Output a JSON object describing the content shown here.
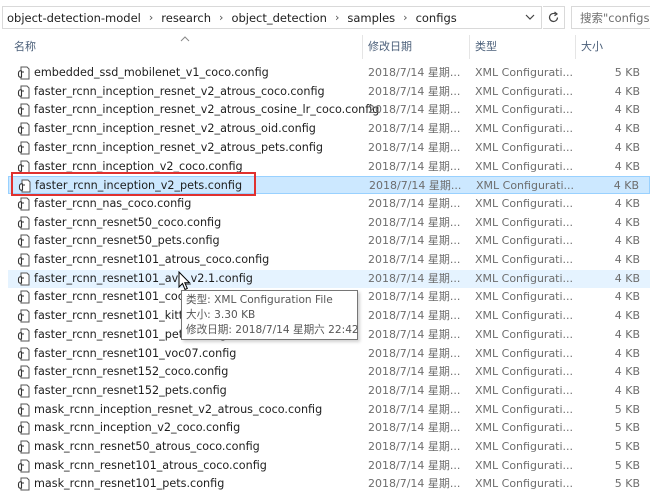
{
  "address": {
    "crumbs": [
      "object-detection-model",
      "research",
      "object_detection",
      "samples",
      "configs"
    ],
    "search_placeholder": "搜索\"configs\""
  },
  "columns": {
    "name": "名称",
    "date": "修改日期",
    "type": "类型",
    "size": "大小"
  },
  "files": [
    {
      "name": "embedded_ssd_mobilenet_v1_coco.config",
      "date": "2018/7/14 星期...",
      "type": "XML Configurati...",
      "size": "5 KB"
    },
    {
      "name": "faster_rcnn_inception_resnet_v2_atrous_coco.config",
      "date": "2018/7/14 星期...",
      "type": "XML Configurati...",
      "size": "4 KB"
    },
    {
      "name": "faster_rcnn_inception_resnet_v2_atrous_cosine_lr_coco.config",
      "date": "2018/7/14 星期...",
      "type": "XML Configurati...",
      "size": "4 KB"
    },
    {
      "name": "faster_rcnn_inception_resnet_v2_atrous_oid.config",
      "date": "2018/7/14 星期...",
      "type": "XML Configurati...",
      "size": "4 KB"
    },
    {
      "name": "faster_rcnn_inception_resnet_v2_atrous_pets.config",
      "date": "2018/7/14 星期...",
      "type": "XML Configurati...",
      "size": "4 KB"
    },
    {
      "name": "faster_rcnn_inception_v2_coco.config",
      "date": "2018/7/14 星期...",
      "type": "XML Configurati...",
      "size": "4 KB"
    },
    {
      "name": "faster_rcnn_inception_v2_pets.config",
      "date": "2018/7/14 星期...",
      "type": "XML Configurati...",
      "size": "4 KB"
    },
    {
      "name": "faster_rcnn_nas_coco.config",
      "date": "2018/7/14 星期...",
      "type": "XML Configurati...",
      "size": "4 KB"
    },
    {
      "name": "faster_rcnn_resnet50_coco.config",
      "date": "2018/7/14 星期...",
      "type": "XML Configurati...",
      "size": "4 KB"
    },
    {
      "name": "faster_rcnn_resnet50_pets.config",
      "date": "2018/7/14 星期...",
      "type": "XML Configurati...",
      "size": "4 KB"
    },
    {
      "name": "faster_rcnn_resnet101_atrous_coco.config",
      "date": "2018/7/14 星期...",
      "type": "XML Configurati...",
      "size": "4 KB"
    },
    {
      "name": "faster_rcnn_resnet101_ava_v2.1.config",
      "date": "2018/7/14 星期...",
      "type": "XML Configurati...",
      "size": "4 KB"
    },
    {
      "name": "faster_rcnn_resnet101_coco.config",
      "date": "2018/7/14 星期...",
      "type": "XML Configurati...",
      "size": "4 KB"
    },
    {
      "name": "faster_rcnn_resnet101_kitti.config",
      "date": "2018/7/14 星期...",
      "type": "XML Configurati...",
      "size": "4 KB"
    },
    {
      "name": "faster_rcnn_resnet101_pets.config",
      "date": "2018/7/14 星期...",
      "type": "XML Configurati...",
      "size": "4 KB"
    },
    {
      "name": "faster_rcnn_resnet101_voc07.config",
      "date": "2018/7/14 星期...",
      "type": "XML Configurati...",
      "size": "4 KB"
    },
    {
      "name": "faster_rcnn_resnet152_coco.config",
      "date": "2018/7/14 星期...",
      "type": "XML Configurati...",
      "size": "4 KB"
    },
    {
      "name": "faster_rcnn_resnet152_pets.config",
      "date": "2018/7/14 星期...",
      "type": "XML Configurati...",
      "size": "4 KB"
    },
    {
      "name": "mask_rcnn_inception_resnet_v2_atrous_coco.config",
      "date": "2018/7/14 星期...",
      "type": "XML Configurati...",
      "size": "5 KB"
    },
    {
      "name": "mask_rcnn_inception_v2_coco.config",
      "date": "2018/7/14 星期...",
      "type": "XML Configurati...",
      "size": "5 KB"
    },
    {
      "name": "mask_rcnn_resnet50_atrous_coco.config",
      "date": "2018/7/14 星期...",
      "type": "XML Configurati...",
      "size": "5 KB"
    },
    {
      "name": "mask_rcnn_resnet101_atrous_coco.config",
      "date": "2018/7/14 星期...",
      "type": "XML Configurati...",
      "size": "5 KB"
    },
    {
      "name": "mask_rcnn_resnet101_pets.config",
      "date": "2018/7/14 星期...",
      "type": "XML Configurati...",
      "size": "5 KB"
    }
  ],
  "selected_index": 6,
  "hover_index": 11,
  "tooltip": {
    "type_line": "类型: XML Configuration File",
    "size_line": "大小: 3.30 KB",
    "date_line": "修改日期: 2018/7/14 星期六 22:42"
  },
  "colors": {
    "selection_fill": "#cce8ff",
    "hover_fill": "#e5f3ff",
    "highlight_box": "#e0312f"
  }
}
